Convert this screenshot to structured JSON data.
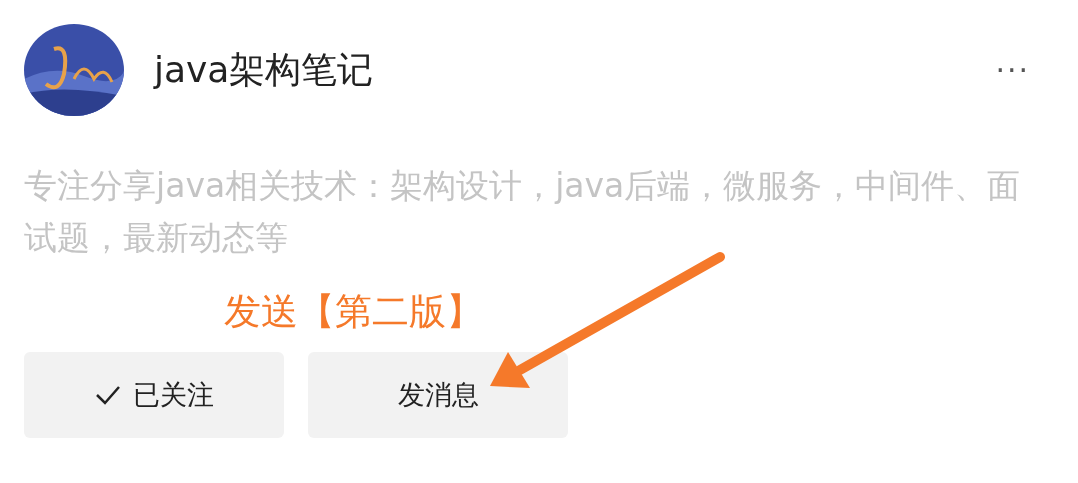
{
  "profile": {
    "name": "java架构笔记",
    "menu": "···",
    "description": "专注分享java相关技术：架构设计，java后端，微服务，中间件、面试题，最新动态等",
    "buttons": [
      {
        "label": "已关注",
        "followed": true
      },
      {
        "label": "发消息"
      }
    ]
  },
  "annotation": {
    "text": "发送【第二版】",
    "color": "#f5792a"
  }
}
